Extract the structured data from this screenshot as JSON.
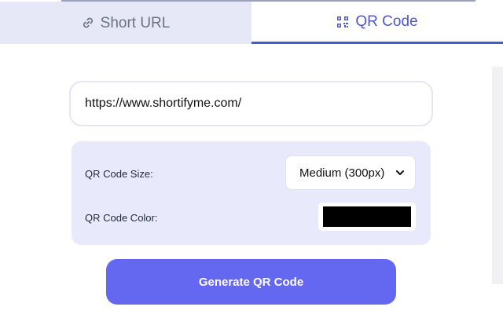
{
  "tabs": {
    "short_url": {
      "label": "Short URL",
      "icon": "link-icon",
      "active": false
    },
    "qr_code": {
      "label": "QR Code",
      "icon": "qr-code-icon",
      "active": true
    }
  },
  "url_input": {
    "value": "https://www.shortifyme.com/",
    "placeholder": ""
  },
  "options": {
    "size_label": "QR Code Size:",
    "size_selected": "Medium (300px)",
    "color_label": "QR Code Color:",
    "color_value": "#000000"
  },
  "generate_button": {
    "label": "Generate QR Code"
  },
  "colors": {
    "accent": "#6467F0",
    "active_tab": "#4D58C8",
    "inactive_tab_bg": "#E6E8F7",
    "options_bg": "#E8E9FB"
  }
}
